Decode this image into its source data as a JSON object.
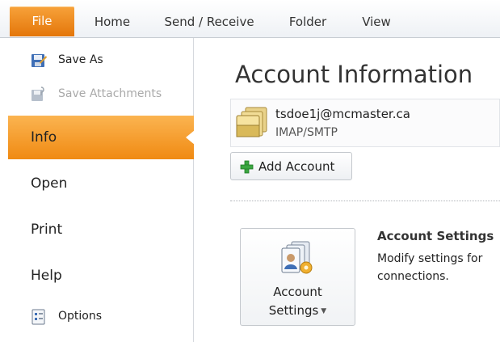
{
  "ribbon": {
    "tabs": [
      {
        "label": "File",
        "active": true
      },
      {
        "label": "Home"
      },
      {
        "label": "Send / Receive"
      },
      {
        "label": "Folder"
      },
      {
        "label": "View"
      }
    ],
    "accent": "#f08a12"
  },
  "nav": {
    "items": [
      {
        "label": "Save As",
        "icon": "save-as-icon"
      },
      {
        "label": "Save Attachments",
        "icon": "save-attachments-icon",
        "disabled": true
      },
      {
        "label": "Info",
        "active": true
      },
      {
        "label": "Open"
      },
      {
        "label": "Print"
      },
      {
        "label": "Help"
      },
      {
        "label": "Options",
        "icon": "options-icon"
      }
    ]
  },
  "main": {
    "title": "Account Information",
    "account": {
      "email": "tsdoe1j@mcmaster.ca",
      "type": "IMAP/SMTP",
      "icon": "account-folder-icon"
    },
    "add_account_label": "Add Account",
    "settings_button": {
      "line1": "Account",
      "line2": "Settings"
    },
    "section": {
      "title": "Account Settings",
      "description_line1": "Modify settings for",
      "description_line2": "connections."
    }
  }
}
